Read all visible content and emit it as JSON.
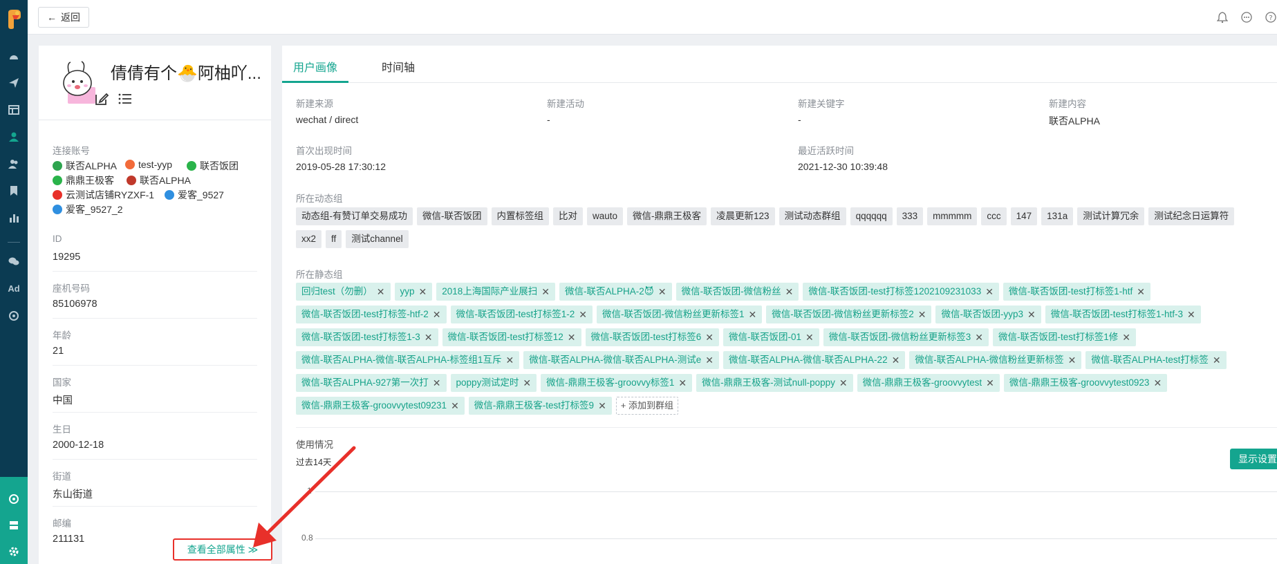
{
  "topbar": {
    "back_label": "返回"
  },
  "profile": {
    "name": "倩倩有个🐣阿柚吖...",
    "connected_accounts_label": "连接账号",
    "accounts": [
      {
        "name": "联否ALPHA",
        "color": "#2ea44f"
      },
      {
        "name": "test-yyp",
        "color": "#f26b3a"
      },
      {
        "name": "联否饭团",
        "color": "#2ab34a"
      },
      {
        "name": "鼎鼎王极客",
        "color": "#2ab34a"
      },
      {
        "name": "联否ALPHA",
        "color": "#c0392b"
      },
      {
        "name": "云测试店铺RYZXF-1",
        "color": "#e8302a"
      },
      {
        "name": "爱客_9527",
        "color": "#2f8fe0"
      },
      {
        "name": "爱客_9527_2",
        "color": "#2f8fe0"
      }
    ],
    "fields": [
      {
        "label": "ID",
        "value": "19295"
      },
      {
        "label": "座机号码",
        "value": "85106978"
      },
      {
        "label": "年龄",
        "value": "21"
      },
      {
        "label": "国家",
        "value": "中国"
      },
      {
        "label": "生日",
        "value": "2000-12-18"
      },
      {
        "label": "街道",
        "value": "东山街道"
      },
      {
        "label": "邮编",
        "value": "211131"
      }
    ],
    "view_all_label": "查看全部属性 ≫"
  },
  "tabs": {
    "portrait": "用户画像",
    "timeline": "时间轴"
  },
  "info": {
    "source_label": "新建来源",
    "source_value": "wechat / direct",
    "activity_label": "新建活动",
    "activity_value": "-",
    "keyword_label": "新建关键字",
    "keyword_value": "-",
    "content_label": "新建内容",
    "content_value": "联否ALPHA",
    "first_seen_label": "首次出现时间",
    "first_seen_value": "2019-05-28 17:30:12",
    "last_active_label": "最近活跃时间",
    "last_active_value": "2021-12-30 10:39:48"
  },
  "dynamic_groups": {
    "label": "所在动态组",
    "row1": [
      "动态组-有赞订单交易成功",
      "微信-联否饭团",
      "内置标签组",
      "比对",
      "wauto",
      "微信-鼎鼎王极客",
      "凌晨更新123",
      "测试动态群组",
      "qqqqqq",
      "333",
      "mmmmm",
      "ccc",
      "147",
      "131a",
      "测试计算冗余",
      "测试纪念日运算符"
    ],
    "row2": [
      "xx2",
      "ff",
      "测试channel"
    ]
  },
  "static_groups": {
    "label": "所在静态组",
    "rows": [
      [
        "回归test（勿删）",
        "yyp",
        "2018上海国际产业展扫",
        "微信-联否ALPHA-2😈",
        "微信-联否饭团-微信粉丝",
        "微信-联否饭团-test打标签1202109231033",
        "微信-联否饭团-test打标签1-htf"
      ],
      [
        "微信-联否饭团-test打标签-htf-2",
        "微信-联否饭团-test打标签1-2",
        "微信-联否饭团-微信粉丝更新标签1",
        "微信-联否饭团-微信粉丝更新标签2",
        "微信-联否饭团-yyp3",
        "微信-联否饭团-test打标签1-htf-3"
      ],
      [
        "微信-联否饭团-test打标签1-3",
        "微信-联否饭团-test打标签12",
        "微信-联否饭团-test打标签6",
        "微信-联否饭团-01",
        "微信-联否饭团-微信粉丝更新标签3",
        "微信-联否饭团-test打标签1修"
      ],
      [
        "微信-联否ALPHA-微信-联否ALPHA-标签组1互斥",
        "微信-联否ALPHA-微信-联否ALPHA-测试e",
        "微信-联否ALPHA-微信-联否ALPHA-22",
        "微信-联否ALPHA-微信粉丝更新标签",
        "微信-联否ALPHA-test打标签"
      ],
      [
        "微信-联否ALPHA-927第一次打",
        "poppy测试定时",
        "微信-鼎鼎王极客-groovvy标签1",
        "微信-鼎鼎王极客-测试null-poppy",
        "微信-鼎鼎王极客-groovvytest",
        "微信-鼎鼎王极客-groovvytest0923"
      ],
      [
        "微信-鼎鼎王极客-groovvytest09231",
        "微信-鼎鼎王极客-test打标签9"
      ]
    ],
    "add_label": "+ 添加到群组"
  },
  "usage": {
    "label": "使用情况",
    "period": "过去14天",
    "display_settings": "显示设置",
    "ticks": [
      "1",
      "0.8"
    ]
  }
}
